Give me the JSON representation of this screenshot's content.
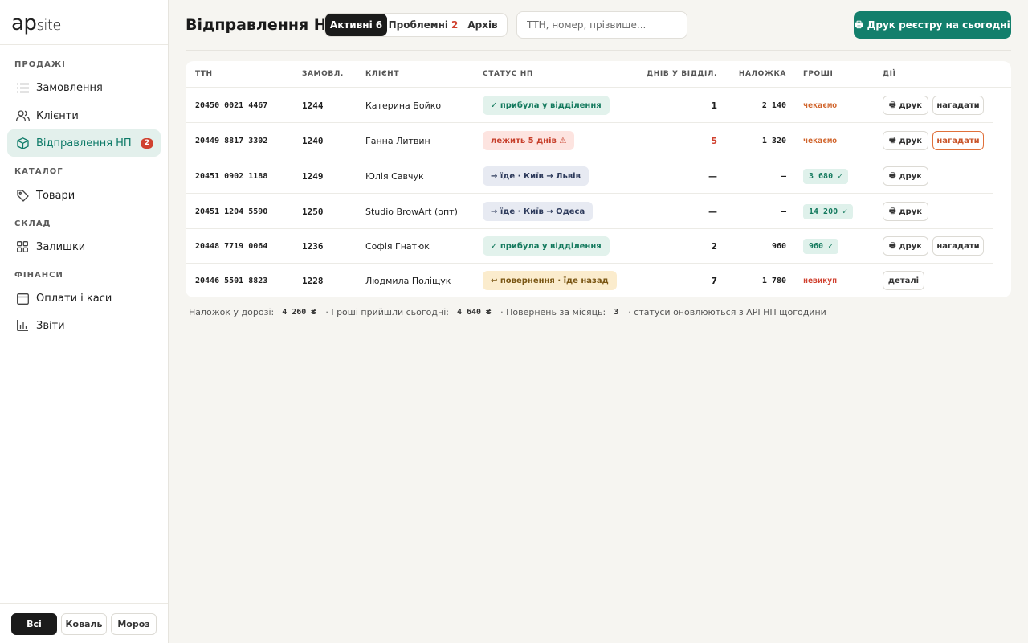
{
  "app": {
    "logo_ap": "ap",
    "logo_site": "site"
  },
  "sidebar": {
    "sections": [
      {
        "title": "ПРОДАЖІ"
      },
      {
        "title": "КАТАЛОГ"
      },
      {
        "title": "СКЛАД"
      },
      {
        "title": "ФІНАНСИ"
      }
    ],
    "items": [
      {
        "label": "Замовлення",
        "icon": "list-icon"
      },
      {
        "label": "Клієнти",
        "icon": "users-icon"
      },
      {
        "label": "Відправлення НП",
        "icon": "box-icon",
        "badge": "2",
        "active": true
      },
      {
        "label": "Товари",
        "icon": "tag-icon"
      },
      {
        "label": "Залишки",
        "icon": "grid-icon"
      },
      {
        "label": "Оплати і каси",
        "icon": "calendar-icon"
      },
      {
        "label": "Звіти",
        "icon": "bar-chart-icon"
      }
    ],
    "users": [
      "Всі",
      "Коваль",
      "Мороз"
    ]
  },
  "header": {
    "title": "Відправлення НП",
    "tabs": [
      {
        "label": "Активні",
        "count": "6"
      },
      {
        "label": "Проблемні",
        "count": "2"
      },
      {
        "label": "Архів",
        "count": ""
      }
    ],
    "search_placeholder": "ТТН, номер, прізвище...",
    "print_label": "Друк реєстру на сьогодні"
  },
  "table": {
    "columns": [
      "ТТН",
      "ЗАМОВЛ.",
      "КЛІЄНТ",
      "СТАТУС НП",
      "ДНІВ У ВІДДІЛ.",
      "НАЛОЖКА",
      "ГРОШІ",
      "ДІЇ"
    ],
    "rows": [
      {
        "ttn": "20450 0021 4467",
        "order": "1244",
        "client": "Катерина Бойко",
        "status": "✓ прибула у відділення",
        "status_kind": "arrived",
        "days": "1",
        "cod": "2 140",
        "money": "чекаємо",
        "money_kind": "wait",
        "actions": [
          "друк",
          "нагадати"
        ]
      },
      {
        "ttn": "20449 8817 3302",
        "order": "1240",
        "client": "Ганна Литвин",
        "status": "лежить 5 днів ⚠",
        "status_kind": "problem",
        "days": "5",
        "cod": "1 320",
        "money": "чекаємо",
        "money_kind": "wait",
        "actions": [
          "друк",
          "нагадати"
        ]
      },
      {
        "ttn": "20451 0902 1188",
        "order": "1249",
        "client": "Юлія Савчук",
        "status": "→ їде · Київ → Львів",
        "status_kind": "transit",
        "days": "—",
        "cod": "—",
        "money": "3 680 ✓",
        "money_kind": "paid",
        "actions": [
          "друк"
        ]
      },
      {
        "ttn": "20451 1204 5590",
        "order": "1250",
        "client": "Studio BrowArt (опт)",
        "status": "→ їде · Київ → Одеса",
        "status_kind": "transit",
        "days": "—",
        "cod": "—",
        "money": "14 200 ✓",
        "money_kind": "paid",
        "actions": [
          "друк"
        ]
      },
      {
        "ttn": "20448 7719 0064",
        "order": "1236",
        "client": "Софія Гнатюк",
        "status": "✓ прибула у відділення",
        "status_kind": "arrived",
        "days": "2",
        "cod": "960",
        "money": "960 ✓",
        "money_kind": "paid",
        "actions": [
          "друк",
          "нагадати"
        ]
      },
      {
        "ttn": "20446 5501 8823",
        "order": "1228",
        "client": "Людмила Поліщук",
        "status": "↩ повернення · їде назад",
        "status_kind": "return",
        "days": "7",
        "cod": "1 780",
        "money": "невикуп",
        "money_kind": "fail",
        "actions": [
          "деталі"
        ]
      }
    ]
  },
  "summary": {
    "cod_label": "Наложок у дорозі:",
    "cod_value": "4 260 ₴",
    "paid_label": "· Гроші прийшли сьогодні:",
    "paid_value": "4 640 ₴",
    "returns_label": "· Повернень за місяць:",
    "returns_value": "3",
    "note": "· статуси оновлюються з API НП щогодини"
  }
}
